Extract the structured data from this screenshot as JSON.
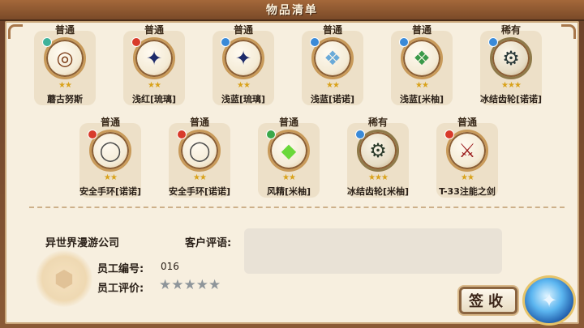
{
  "window": {
    "title": "物品清单"
  },
  "items_row1": [
    {
      "rarity": "普通",
      "name": "蘑古努斯",
      "stars": "★★",
      "icon": "donut-ring-icon",
      "gem_color": "#3fb29a",
      "glyph": "◎",
      "glyph_color": "#7a3a14"
    },
    {
      "rarity": "普通",
      "name": "浅红[琉璃]",
      "stars": "★★",
      "icon": "starry-necklace-icon",
      "gem_color": "#d83a2a",
      "glyph": "✦",
      "glyph_color": "#1c2a6a"
    },
    {
      "rarity": "普通",
      "name": "浅蓝[琉璃]",
      "stars": "★★",
      "icon": "starry-necklace-icon",
      "gem_color": "#3a8ad8",
      "glyph": "✦",
      "glyph_color": "#1c2a6a"
    },
    {
      "rarity": "普通",
      "name": "浅蓝[诺诺]",
      "stars": "★★",
      "icon": "crystal-pendant-icon",
      "gem_color": "#3a8ad8",
      "glyph": "❖",
      "glyph_color": "#6aaad8"
    },
    {
      "rarity": "普通",
      "name": "浅蓝[米柚]",
      "stars": "★★",
      "icon": "green-pendant-icon",
      "gem_color": "#3a8ad8",
      "glyph": "❖",
      "glyph_color": "#3a9a4a"
    },
    {
      "rarity": "稀有",
      "name": "冰结齿轮[诺诺]",
      "stars": "★★★",
      "icon": "frozen-gear-icon",
      "gem_color": "#3a8ad8",
      "glyph": "⚙",
      "glyph_color": "#2a3a3a"
    }
  ],
  "items_row2": [
    {
      "rarity": "普通",
      "name": "安全手环[诺诺]",
      "stars": "★★",
      "icon": "bracelet-icon",
      "gem_color": "#d83a2a",
      "glyph": "◯",
      "glyph_color": "#4a4a4a"
    },
    {
      "rarity": "普通",
      "name": "安全手环[诺诺]",
      "stars": "★★",
      "icon": "bracelet-icon",
      "gem_color": "#d83a2a",
      "glyph": "◯",
      "glyph_color": "#4a4a4a"
    },
    {
      "rarity": "普通",
      "name": "风精[米柚]",
      "stars": "★★",
      "icon": "wind-gem-icon",
      "gem_color": "#3aa84a",
      "glyph": "◆",
      "glyph_color": "#6ad83a"
    },
    {
      "rarity": "稀有",
      "name": "冰结齿轮[米柚]",
      "stars": "★★★",
      "icon": "frozen-gear-icon",
      "gem_color": "#3a8ad8",
      "glyph": "⚙",
      "glyph_color": "#2a3a2a"
    },
    {
      "rarity": "普通",
      "name": "T-33注能之剑",
      "stars": "★★",
      "icon": "crimson-sword-icon",
      "gem_color": "#d83a2a",
      "glyph": "⚔",
      "glyph_color": "#9a1a1a"
    }
  ],
  "info": {
    "company": "异世界漫游公司",
    "review_label": "客户评语:",
    "review_text": "",
    "employee_id_label": "员工编号:",
    "employee_id_value": "016",
    "employee_rating_label": "员工评价:",
    "employee_rating_stars": "★★★★★"
  },
  "actions": {
    "sign_label": "签收"
  },
  "colors": {
    "frame": "#7a4a28",
    "parchment": "#f7efdf",
    "star_gold": "#d9a21a",
    "rating_star_grey": "#8e959a"
  }
}
